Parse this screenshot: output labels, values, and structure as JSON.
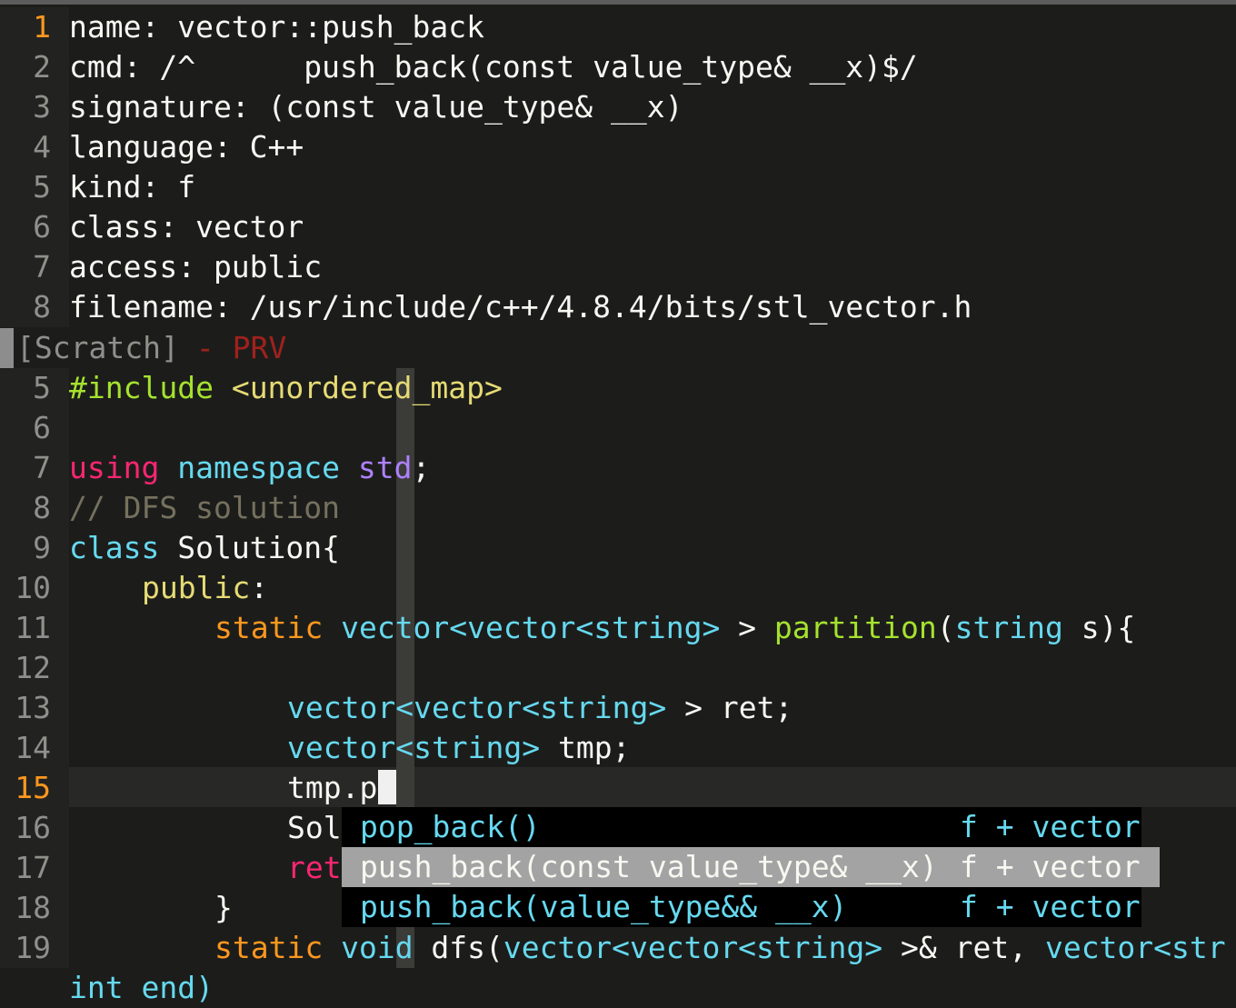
{
  "preview": {
    "lines": [
      {
        "num": "1",
        "text": "name: vector::push_back"
      },
      {
        "num": "2",
        "text": "cmd: /^      push_back(const value_type& __x)$/"
      },
      {
        "num": "3",
        "text": "signature: (const value_type& __x)"
      },
      {
        "num": "4",
        "text": "language: C++"
      },
      {
        "num": "5",
        "text": "kind: f"
      },
      {
        "num": "6",
        "text": "class: vector"
      },
      {
        "num": "7",
        "text": "access: public"
      },
      {
        "num": "8",
        "text": "filename: /usr/include/c++/4.8.4/bits/stl_vector.h"
      }
    ]
  },
  "statusline": {
    "name": "[Scratch]",
    "tag": " - PRV"
  },
  "editor": {
    "lines": {
      "l5": {
        "num": "5",
        "include": "#include",
        "header": " <unordered_map>"
      },
      "l6": {
        "num": "6"
      },
      "l7": {
        "num": "7",
        "kw": "using",
        "ns": " namespace",
        "std": " std",
        "semi": ";"
      },
      "l8": {
        "num": "8",
        "comment": "// DFS solution"
      },
      "l9": {
        "num": "9",
        "kw": "class",
        "rest": " Solution{"
      },
      "l10": {
        "num": "10",
        "pub": "public",
        "colon": ":"
      },
      "l11": {
        "num": "11",
        "static": "static",
        "t1": " vector<vector<string>",
        "gt": " > ",
        "fn": "partition",
        "p1": "(",
        "t2": "string",
        "p2": " s){"
      },
      "l12": {
        "num": "12"
      },
      "l13": {
        "num": "13",
        "t1": "vector<vector<string>",
        "rest": " > ret;"
      },
      "l14": {
        "num": "14",
        "t1": "vector<string>",
        "rest": " tmp;"
      },
      "l15": {
        "num": "15",
        "text": "tmp.p"
      },
      "l16": {
        "num": "16",
        "text": "Sol"
      },
      "l17": {
        "num": "17",
        "kw": "ret"
      },
      "l18": {
        "num": "18",
        "text": "}"
      },
      "l19": {
        "num": "19",
        "static": "static",
        "void": " void",
        "rest1": " dfs(",
        "t1": "vector<vector<string>",
        "rest2": " >& ret, ",
        "t2": "vector<str"
      },
      "l20": {
        "text": "int end)"
      }
    }
  },
  "completion": {
    "items": [
      {
        "word": "pop_back()",
        "kind": "f + vector"
      },
      {
        "word": "push_back(const value_type& __x)",
        "kind": "f + vector"
      },
      {
        "word": "push_back(value_type&& __x)",
        "kind": "f + vector"
      }
    ]
  },
  "colors": {
    "background": "#1c1d1b",
    "keyword": "#f92672",
    "type": "#66d9ef",
    "function": "#a6e22e",
    "string": "#e6db74",
    "comment": "#75715e",
    "number_current": "#fd971f",
    "popup_selected": "#a3a3a3"
  }
}
